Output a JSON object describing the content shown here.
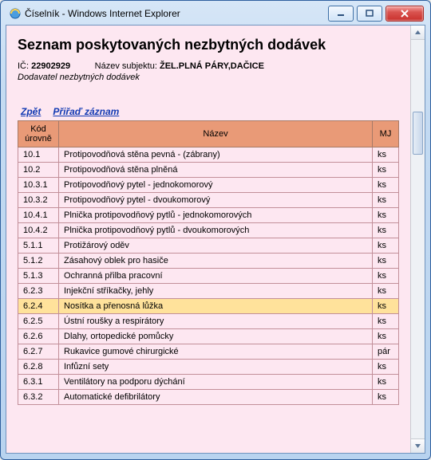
{
  "window": {
    "title": "Číselník - Windows Internet Explorer"
  },
  "page": {
    "heading": "Seznam poskytovaných nezbytných dodávek",
    "ic_label": "IČ:",
    "ic_value": "22902929",
    "subject_label": "Název subjektu:",
    "subject_value": "ŽEL.PLNÁ PÁRY,DAČICE",
    "supplier_note": "Dodavatel nezbytných dodávek"
  },
  "links": {
    "back": "Zpět",
    "assign": "Přiřaď záznam"
  },
  "table": {
    "headers": {
      "code": "Kód úrovně",
      "name": "Název",
      "mj": "MJ"
    },
    "rows": [
      {
        "code": "10.1",
        "name": "Protipovodňová stěna pevná - (zábrany)",
        "mj": "ks"
      },
      {
        "code": "10.2",
        "name": "Protipovodňová stěna plněná",
        "mj": "ks"
      },
      {
        "code": "10.3.1",
        "name": "Protipovodňový pytel - jednokomorový",
        "mj": "ks"
      },
      {
        "code": "10.3.2",
        "name": "Protipovodňový pytel - dvoukomorový",
        "mj": "ks"
      },
      {
        "code": "10.4.1",
        "name": "Plnička protipovodňový pytlů - jednokomorových",
        "mj": "ks"
      },
      {
        "code": "10.4.2",
        "name": "Plnička protipovodňový pytlů - dvoukomorových",
        "mj": "ks"
      },
      {
        "code": "5.1.1",
        "name": "Protižárový oděv",
        "mj": "ks"
      },
      {
        "code": "5.1.2",
        "name": "Zásahový oblek pro hasiče",
        "mj": "ks"
      },
      {
        "code": "5.1.3",
        "name": "Ochranná přilba pracovní",
        "mj": "ks"
      },
      {
        "code": "6.2.3",
        "name": "Injekční stříkačky, jehly",
        "mj": "ks"
      },
      {
        "code": "6.2.4",
        "name": "Nosítka a přenosná lůžka",
        "mj": "ks",
        "highlight": true
      },
      {
        "code": "6.2.5",
        "name": "Ústní roušky a respirátory",
        "mj": "ks"
      },
      {
        "code": "6.2.6",
        "name": "Dlahy, ortopedické pomůcky",
        "mj": "ks"
      },
      {
        "code": "6.2.7",
        "name": "Rukavice gumové chirurgické",
        "mj": "pár"
      },
      {
        "code": "6.2.8",
        "name": "Infůzní sety",
        "mj": "ks"
      },
      {
        "code": "6.3.1",
        "name": "Ventilátory na podporu dýchání",
        "mj": "ks"
      },
      {
        "code": "6.3.2",
        "name": "Automatické defibrilátory",
        "mj": "ks"
      }
    ]
  }
}
